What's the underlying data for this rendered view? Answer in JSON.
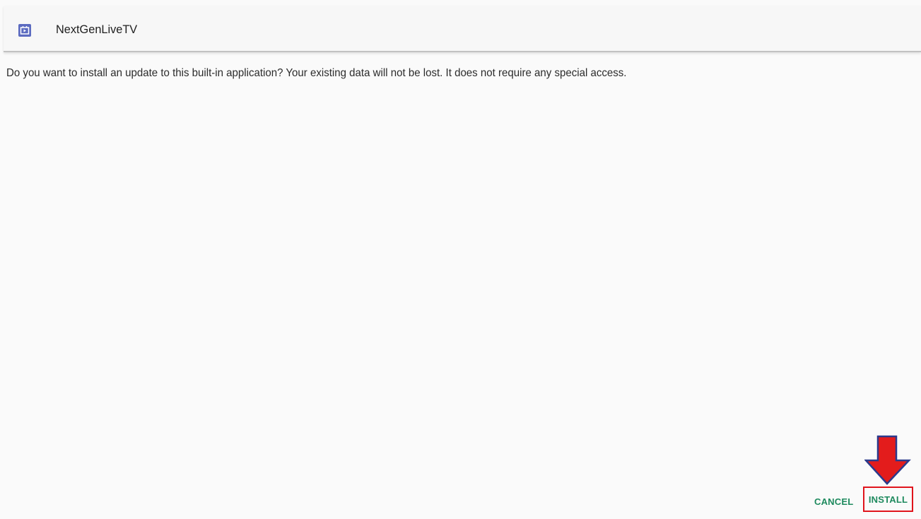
{
  "dialog": {
    "app_name": "NextGenLiveTV",
    "app_icon": "tv-app-icon",
    "message": "Do you want to install an update to this built-in application? Your existing data will not be lost. It does not require any special access.",
    "cancel_label": "CANCEL",
    "install_label": "INSTALL"
  },
  "annotation": {
    "icon": "down-arrow-icon",
    "fill_color": "#e31c1c",
    "stroke_color": "#2b3a8c",
    "highlight_color": "#e0141c"
  },
  "colors": {
    "background": "#fafafa",
    "header_background": "#f7f7f7",
    "app_icon": "#5c6bc0",
    "button_text": "#1e8a5e",
    "message_text": "#2b2b2b"
  }
}
